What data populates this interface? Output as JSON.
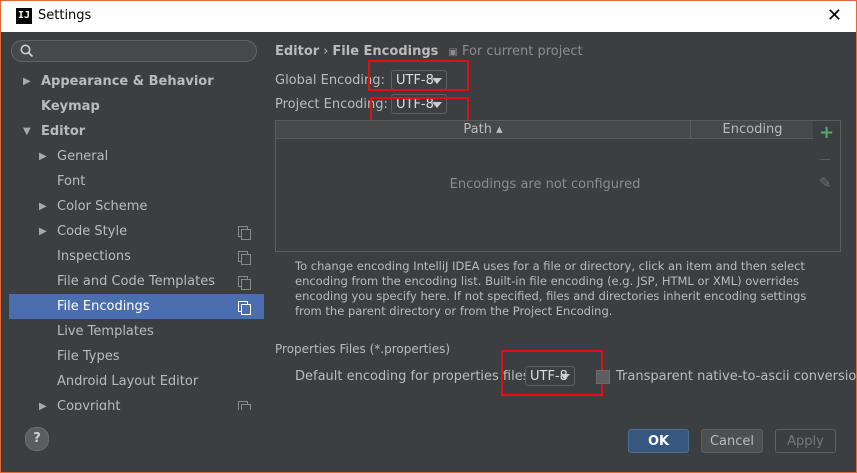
{
  "window": {
    "title": "Settings",
    "app_icon": "IJ"
  },
  "search": {
    "placeholder": ""
  },
  "sidebar": {
    "items": [
      {
        "label": "Appearance & Behavior",
        "level": 0,
        "expandable": true,
        "expanded": false,
        "bold": true
      },
      {
        "label": "Keymap",
        "level": 0,
        "expandable": false,
        "bold": true
      },
      {
        "label": "Editor",
        "level": 0,
        "expandable": true,
        "expanded": true,
        "bold": true
      },
      {
        "label": "General",
        "level": 1,
        "expandable": true,
        "expanded": false
      },
      {
        "label": "Font",
        "level": 1,
        "expandable": false
      },
      {
        "label": "Color Scheme",
        "level": 1,
        "expandable": true,
        "expanded": false
      },
      {
        "label": "Code Style",
        "level": 1,
        "expandable": true,
        "expanded": false,
        "project": true
      },
      {
        "label": "Inspections",
        "level": 1,
        "expandable": false,
        "project": true
      },
      {
        "label": "File and Code Templates",
        "level": 1,
        "expandable": false,
        "project": true
      },
      {
        "label": "File Encodings",
        "level": 1,
        "expandable": false,
        "project": true,
        "selected": true
      },
      {
        "label": "Live Templates",
        "level": 1,
        "expandable": false
      },
      {
        "label": "File Types",
        "level": 1,
        "expandable": false
      },
      {
        "label": "Android Layout Editor",
        "level": 1,
        "expandable": false
      },
      {
        "label": "Copyright",
        "level": 1,
        "expandable": true,
        "expanded": false,
        "project": true
      }
    ]
  },
  "breadcrumb": {
    "parent": "Editor",
    "separator": "›",
    "current": "File Encodings",
    "note": "For current project"
  },
  "global_encoding": {
    "label": "Global Encoding:",
    "value": "UTF-8"
  },
  "project_encoding": {
    "label": "Project Encoding:",
    "value": "UTF-8"
  },
  "table": {
    "columns": [
      "Path ▴",
      "Encoding"
    ],
    "empty_text": "Encodings are not configured",
    "tools": {
      "add": "+",
      "remove": "—",
      "edit": "✎"
    }
  },
  "description": "To change encoding IntelliJ IDEA uses for a file or directory, click an item and then select encoding from the encoding list. Built-in file encoding (e.g. JSP, HTML or XML) overrides encoding you specify here. If not specified, files and directories inherit encoding settings from the parent directory or from the Project Encoding.",
  "properties": {
    "section_title": "Properties Files (*.properties)",
    "default_label": "Default encoding for properties files:",
    "value": "UTF-8",
    "checkbox_label": "Transparent native-to-ascii conversion",
    "checkbox_checked": false
  },
  "footer": {
    "help": "?",
    "ok": "OK",
    "cancel": "Cancel",
    "apply": "Apply"
  },
  "colors": {
    "selection": "#4b6eaf",
    "ok_button": "#365880",
    "highlight_box": "#e01010",
    "add_icon": "#59a869"
  }
}
